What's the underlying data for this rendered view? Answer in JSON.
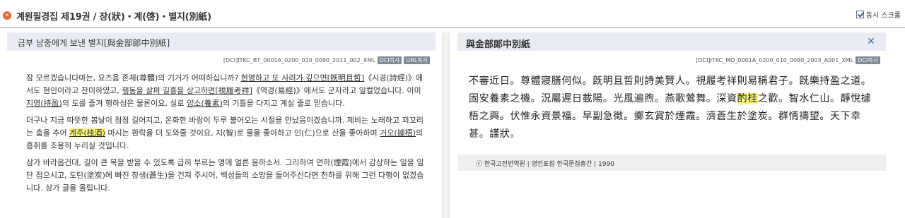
{
  "header": {
    "close_icon": "x-circle-icon",
    "title": "계원필경집 제19권 / 장(狀)・계(啓)・별지(別紙)",
    "sync_label": "동시 스크롤",
    "sync_checked": true
  },
  "left": {
    "title": "금부 낭중에게 보낸 별지[與金部郞中別紙]",
    "source_id": "[DCI]ITKC_BT_0001A_0200_010_0090_2011_002_XML",
    "tags": [
      "DCI복사",
      "URL복사"
    ],
    "paragraphs": [
      {
        "parts": [
          {
            "t": "잠 모르겠습니다마는, 요즈음 존체(尊體)의 기거가 어떠하십니까? "
          },
          {
            "t": "현명하고 또 사려가 깊으면[旣明且哲]",
            "u": true
          },
          {
            "t": "《시경(詩經)》에서도 현인이라고 찬미하였고, "
          },
          {
            "t": "행동을 살펴 길흉을 상고하면[視履考祥]",
            "u": true
          },
          {
            "t": "《역경(易經)》에서도 군자라고 일컬었습니다. 이미 "
          },
          {
            "t": "지영(持盈)",
            "u": true
          },
          {
            "t": "의 도를 즐겨 행하심은 물론이요, 실로 "
          },
          {
            "t": "양소(養素)",
            "u": true
          },
          {
            "t": "의 기틀을 다지고 계실 줄로 믿습니다."
          }
        ]
      },
      {
        "parts": [
          {
            "t": "더구나 지금 따뜻한 봄날이 점점 길어지고, 온화한 바람이 두루 불어오는 시절을 만났음이겠습니까. 제비는 노래하고 꾀꼬리는 춤을 추어 "
          },
          {
            "t": "계주(桂酒)",
            "u": true,
            "h": true
          },
          {
            "t": " 마시는 환락을 더 도와줄 것이요, 지(智)로 물을 좋아하고 인(仁)으로 산을 좋아하며 "
          },
          {
            "t": "거오(據梧)",
            "u": true
          },
          {
            "t": "의 흥취를 조용히 누리실 것입니다."
          }
        ]
      },
      {
        "parts": [
          {
            "t": "삼가 바라옵건대, 길이 큰 복을 받을 수 있도록 급히 부르는 명에 얼른 응하소서. 그리하여 연하(煙霞)에서 감상하는 일을 일단 접으시고, 도탄(塗炭)에 빠진 창생(蒼生)을 건져 주시어, 백성들의 소망을 들어주신다면 천하를 위해 그런 다행이 없겠습니다. 삼가 글을 올립니다."
          }
        ]
      }
    ]
  },
  "right": {
    "title": "與金部郞中別紙",
    "close_icon": "close-x-icon",
    "source_id": "[DCI]ITKC_MO_0001A_0200_010_0090_2003_A001_XML",
    "tags": [
      "DCI복사"
    ],
    "text_before": "不審近日。尊體寢膳何似。旣明且哲則詩美賢人。視履考祥則易稱君子。旣樂持盈之道。固安養素之機。況屬遲日載陽。光風遍煦。燕歌鶯舞。深資",
    "highlight": "酌桂",
    "text_after": "之歡。智水仁山。靜悅據梧之興。伏惟永資景福。早副急徵。擲玄賞於煙霞。濟蒼生於塗炭。群情禱望。天下幸甚。謹狀。",
    "footer": "ⓒ 한국고전번역원 | 영인표점 한국문집총간 | 1990"
  }
}
